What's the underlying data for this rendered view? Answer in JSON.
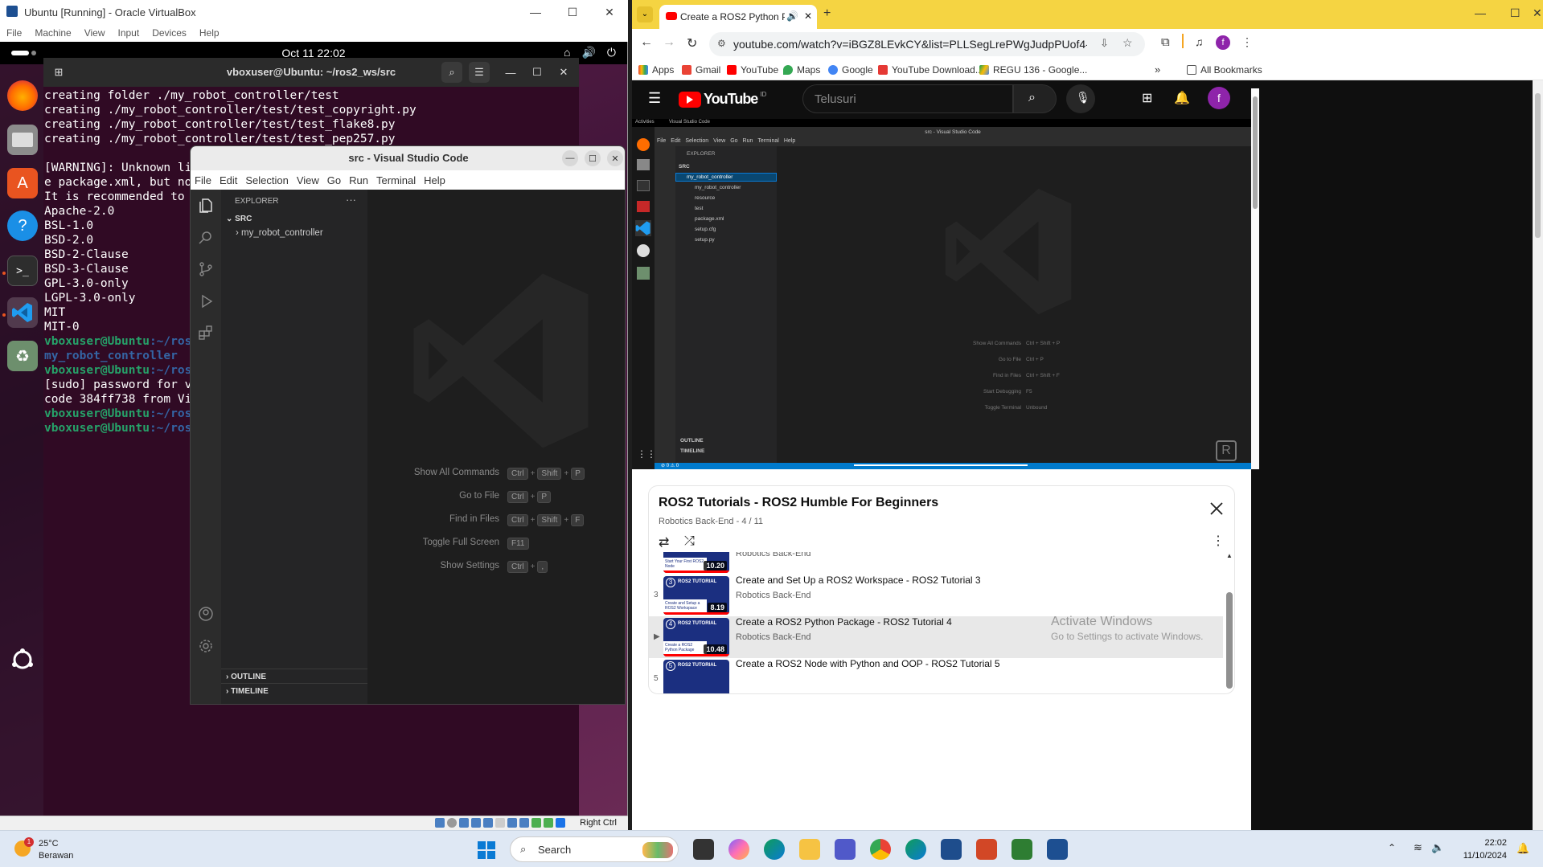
{
  "vbox": {
    "title": "Ubuntu [Running] - Oracle VirtualBox",
    "menu": [
      "File",
      "Machine",
      "View",
      "Input",
      "Devices",
      "Help"
    ],
    "status_host_key": "Right Ctrl"
  },
  "ubuntu": {
    "clock": "Oct 11  22:02"
  },
  "terminal": {
    "title": "vboxuser@Ubuntu: ~/ros2_ws/src",
    "lines": [
      {
        "t": "creating folder ./my_robot_controller/test",
        "c": ""
      },
      {
        "t": "creating ./my_robot_controller/test/test_copyright.py",
        "c": ""
      },
      {
        "t": "creating ./my_robot_controller/test/test_flake8.py",
        "c": ""
      },
      {
        "t": "creating ./my_robot_controller/test/test_pep257.py",
        "c": ""
      },
      {
        "t": "",
        "c": ""
      },
      {
        "t": "[WARNING]: Unknown lic",
        "c": ""
      },
      {
        "t": "e package.xml, but no ",
        "c": ""
      },
      {
        "t": "It is recommended to u",
        "c": ""
      },
      {
        "t": "Apache-2.0",
        "c": ""
      },
      {
        "t": "BSL-1.0",
        "c": ""
      },
      {
        "t": "BSD-2.0",
        "c": ""
      },
      {
        "t": "BSD-2-Clause",
        "c": ""
      },
      {
        "t": "BSD-3-Clause",
        "c": ""
      },
      {
        "t": "GPL-3.0-only",
        "c": ""
      },
      {
        "t": "LGPL-3.0-only",
        "c": ""
      },
      {
        "t": "MIT",
        "c": ""
      },
      {
        "t": "MIT-0",
        "c": ""
      },
      {
        "t": "",
        "c": "prompt"
      },
      {
        "t": "my_robot_controller",
        "c": "b"
      },
      {
        "t": "",
        "c": "prompt"
      },
      {
        "t": "[sudo] password for vb",
        "c": ""
      },
      {
        "t": "code 384ff738 from Vis",
        "c": ""
      },
      {
        "t": "",
        "c": "prompt"
      },
      {
        "t": "",
        "c": "prompt"
      }
    ],
    "prompt_user": "vboxuser@Ubuntu",
    "prompt_path": ":~/ros2"
  },
  "vscode": {
    "title": "src - Visual Studio Code",
    "menu": [
      "File",
      "Edit",
      "Selection",
      "View",
      "Go",
      "Run",
      "Terminal",
      "Help"
    ],
    "explorer_label": "EXPLORER",
    "root": "SRC",
    "folder": "my_robot_controller",
    "outline": "OUTLINE",
    "timeline": "TIMELINE",
    "shortcuts": [
      {
        "label": "Show All Commands",
        "keys": [
          "Ctrl",
          "Shift",
          "P"
        ]
      },
      {
        "label": "Go to File",
        "keys": [
          "Ctrl",
          "P"
        ]
      },
      {
        "label": "Find in Files",
        "keys": [
          "Ctrl",
          "Shift",
          "F"
        ]
      },
      {
        "label": "Toggle Full Screen",
        "keys": [
          "F11"
        ]
      },
      {
        "label": "Show Settings",
        "keys": [
          "Ctrl",
          ","
        ]
      }
    ]
  },
  "chrome": {
    "tab_title": "Create a ROS2 Python Pack",
    "url": "youtube.com/watch?v=iBGZ8LEvkCY&list=PLLSegLrePWgJudpPUof4-nVFHGkB62Izy&i...",
    "bookmarks": [
      "Apps",
      "Gmail",
      "YouTube",
      "Maps",
      "Google",
      "YouTube Download...",
      "REGU 136 - Google..."
    ],
    "all_bookmarks": "All Bookmarks"
  },
  "youtube": {
    "search_placeholder": "Telusuri",
    "region": "ID",
    "avatar_letter": "f",
    "video": {
      "activities": "Activities",
      "app": "Visual Studio Code",
      "title": "src - Visual Studio Code",
      "menu": [
        "File",
        "Edit",
        "Selection",
        "View",
        "Go",
        "Run",
        "Terminal",
        "Help"
      ],
      "explorer": "EXPLORER",
      "root": "SRC",
      "tree": [
        "my_robot_controller",
        "my_robot_controller",
        "resource",
        "test",
        "package.xml",
        "setup.cfg",
        "setup.py"
      ],
      "outline": "OUTLINE",
      "timeline": "TIMELINE",
      "shortcuts": [
        {
          "label": "Show All Commands",
          "keys": "Ctrl + Shift + P"
        },
        {
          "label": "Go to File",
          "keys": "Ctrl + P"
        },
        {
          "label": "Find in Files",
          "keys": "Ctrl + Shift + F"
        },
        {
          "label": "Start Debugging",
          "keys": "F5"
        },
        {
          "label": "Toggle Terminal",
          "keys": "Unbound"
        }
      ],
      "status": "⊘ 0 ⚠ 0"
    },
    "playlist": {
      "title": "ROS2 Tutorials - ROS2 Humble For Beginners",
      "subtitle": "Robotics Back-End - 4 / 11",
      "items": [
        {
          "num": "",
          "title": "",
          "channel": "Robotics Back-End",
          "duration": "10.20",
          "thumb_label": "Start Your First ROS2 Node",
          "badge": ""
        },
        {
          "num": "3",
          "title": "Create and Set Up a ROS2 Workspace - ROS2 Tutorial 3",
          "channel": "Robotics Back-End",
          "duration": "8.19",
          "thumb_label": "Create and Setup a ROS2 Workspace",
          "badge": "3"
        },
        {
          "num": "▶",
          "title": "Create a ROS2 Python Package - ROS2 Tutorial 4",
          "channel": "Robotics Back-End",
          "duration": "10.48",
          "thumb_label": "Create a ROS2 Python Package",
          "badge": "4"
        },
        {
          "num": "5",
          "title": "Create a ROS2 Node with Python and OOP - ROS2 Tutorial 5",
          "channel": "",
          "duration": "",
          "thumb_label": "",
          "badge": "5"
        }
      ],
      "thumb_heading": "ROS2 TUTORIAL"
    },
    "watermark": {
      "line1": "Activate Windows",
      "line2": "Go to Settings to activate Windows."
    }
  },
  "taskbar": {
    "temp": "25°C",
    "weather": "Berawan",
    "badge": "1",
    "search": "Search",
    "time": "22:02",
    "date": "11/10/2024"
  },
  "colors": {
    "chrome_tabstrip": "#f5d442",
    "ubuntu_terminal": "#300a24",
    "vscode_bg": "#1e1e1e",
    "youtube_red": "#ff0000",
    "vscode_blue": "#007acc"
  }
}
